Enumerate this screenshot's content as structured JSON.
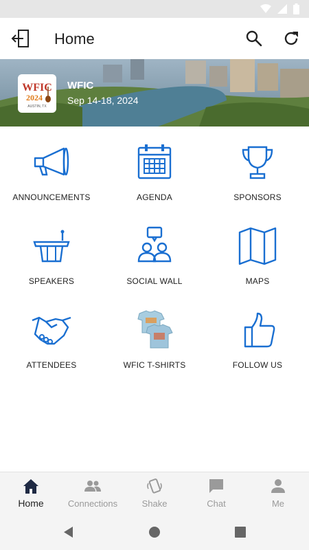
{
  "status_bar": {
    "icons": [
      "wifi-icon",
      "signal-icon",
      "battery-icon"
    ]
  },
  "app_bar": {
    "title": "Home",
    "icons": {
      "back": "logout-icon",
      "search": "search-icon",
      "refresh": "refresh-icon"
    }
  },
  "event": {
    "logo_text": "WFIC",
    "logo_year": "2024",
    "logo_city": "AUSTIN, TX",
    "name": "WFIC",
    "dates": "Sep 14-18, 2024"
  },
  "tiles": [
    {
      "label": "ANNOUNCEMENTS",
      "icon": "megaphone-icon"
    },
    {
      "label": "AGENDA",
      "icon": "calendar-icon"
    },
    {
      "label": "SPONSORS",
      "icon": "trophy-icon"
    },
    {
      "label": "SPEAKERS",
      "icon": "podium-icon"
    },
    {
      "label": "SOCIAL WALL",
      "icon": "social-wall-icon"
    },
    {
      "label": "MAPS",
      "icon": "map-icon"
    },
    {
      "label": "ATTENDEES",
      "icon": "handshake-icon"
    },
    {
      "label": "WFIC T-SHIRTS",
      "icon": "tshirts-image"
    },
    {
      "label": "FOLLOW US",
      "icon": "thumbs-up-icon"
    }
  ],
  "tabs": [
    {
      "label": "Home",
      "icon": "home-icon",
      "active": true
    },
    {
      "label": "Connections",
      "icon": "people-icon",
      "active": false
    },
    {
      "label": "Shake",
      "icon": "shake-phone-icon",
      "active": false
    },
    {
      "label": "Chat",
      "icon": "chat-icon",
      "active": false
    },
    {
      "label": "Me",
      "icon": "person-icon",
      "active": false
    }
  ],
  "colors": {
    "accent_blue": "#1a6fd1",
    "active_tab": "#1f2a44",
    "inactive_tab": "#9a9a9a",
    "logo_red": "#c0392b",
    "logo_orange": "#e07b1a"
  }
}
